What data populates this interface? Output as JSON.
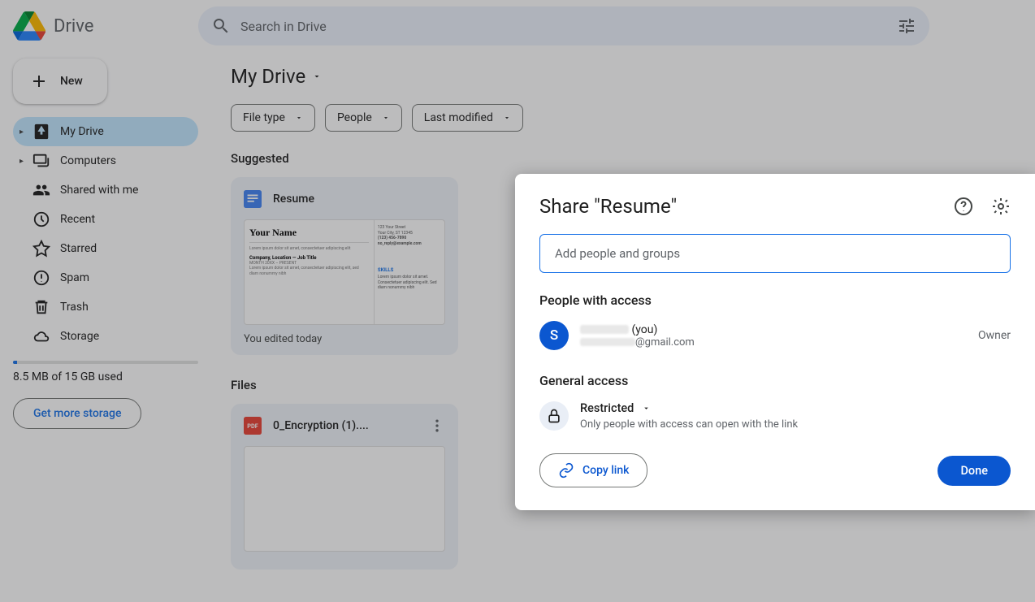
{
  "brand": {
    "name": "Drive"
  },
  "search": {
    "placeholder": "Search in Drive"
  },
  "sidebar": {
    "new_label": "New",
    "items": [
      {
        "label": "My Drive"
      },
      {
        "label": "Computers"
      },
      {
        "label": "Shared with me"
      },
      {
        "label": "Recent"
      },
      {
        "label": "Starred"
      },
      {
        "label": "Spam"
      },
      {
        "label": "Trash"
      },
      {
        "label": "Storage"
      }
    ],
    "storage_text": "8.5 MB of 15 GB used",
    "get_storage": "Get more storage"
  },
  "main": {
    "title": "My Drive",
    "filters": [
      {
        "label": "File type"
      },
      {
        "label": "People"
      },
      {
        "label": "Last modified"
      }
    ],
    "suggested_label": "Suggested",
    "files_label": "Files",
    "suggested": [
      {
        "title": "Resume",
        "subtitle": "You edited today",
        "thumb_name": "Your Name",
        "thumb_section": "Company, Location — Job Title",
        "thumb_skills": "SKILLS",
        "thumb_contact1": "123 Your Street",
        "thumb_contact2": "Your City, ST 12345",
        "thumb_contact3": "(123) 456-7890",
        "thumb_contact4": "no_reply@example.com"
      }
    ],
    "files": [
      {
        "title": "0_Encryption (1)...."
      }
    ]
  },
  "dialog": {
    "title": "Share \"Resume\"",
    "add_placeholder": "Add people and groups",
    "people_hdr": "People with access",
    "person": {
      "initial": "S",
      "suffix": "(you)",
      "email_suffix": "@gmail.com",
      "role": "Owner"
    },
    "general_hdr": "General access",
    "access_level": "Restricted",
    "access_desc": "Only people with access can open with the link",
    "copy_link": "Copy link",
    "done": "Done"
  }
}
